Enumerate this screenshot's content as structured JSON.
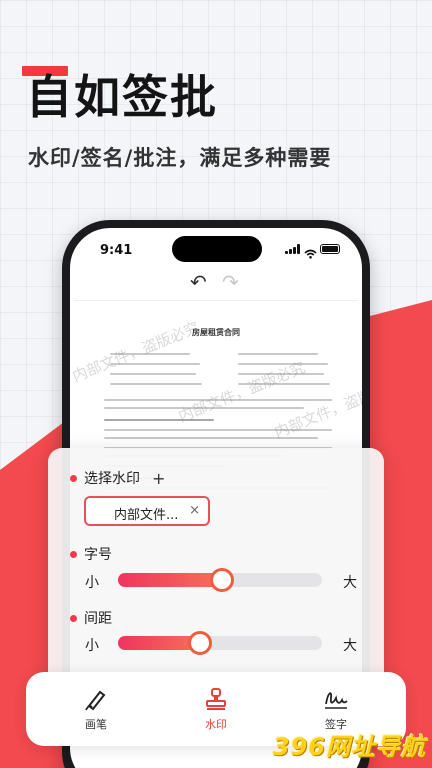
{
  "hero": {
    "title": "自如签批",
    "subtitle": "水印/签名/批注，满足多种需要"
  },
  "status_bar": {
    "time": "9:41"
  },
  "document": {
    "title": "房屋租赁合同",
    "watermark_text": "内部文件，盗版必究"
  },
  "watermark_panel": {
    "select_label": "选择水印",
    "add_symbol": "+",
    "chip_text": "内部文件...",
    "chip_clear": "×",
    "font_size": {
      "label": "字号",
      "min_label": "小",
      "max_label": "大",
      "level": 0.51
    },
    "spacing": {
      "label": "间距",
      "min_label": "小",
      "max_label": "大",
      "level": 0.4
    }
  },
  "toolbar": {
    "tools": [
      {
        "label": "画笔",
        "icon": "pen-icon",
        "active": false
      },
      {
        "label": "水印",
        "icon": "stamp-icon",
        "active": true
      },
      {
        "label": "签字",
        "icon": "signature-icon",
        "active": false
      }
    ]
  },
  "branding": {
    "watermark_logo": "396网址导航"
  },
  "colors": {
    "accent": "#f23a3c",
    "slider": "#f0345e",
    "brand_yellow": "#ffd21a"
  }
}
